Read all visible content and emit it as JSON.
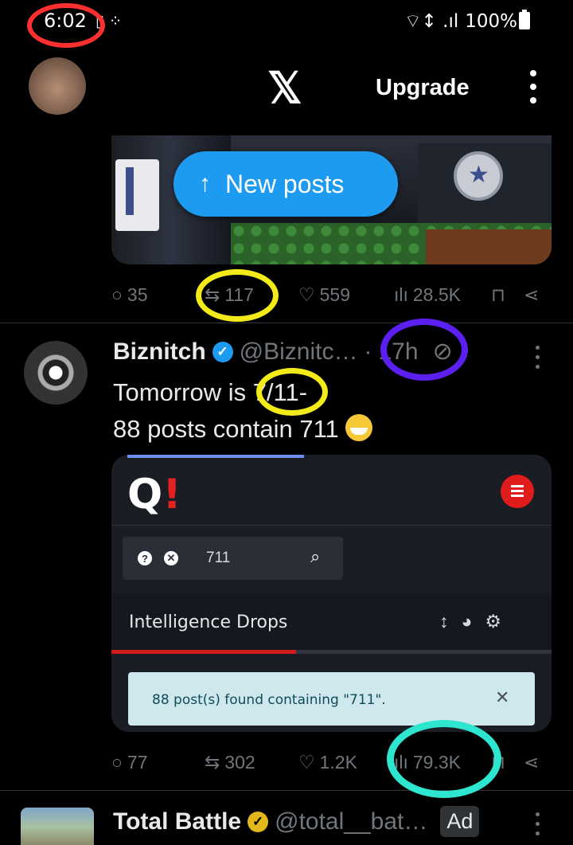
{
  "status_bar": {
    "time": "6:02",
    "left_icons": "▯ ⁘",
    "signal": "⌔↕ .ıl",
    "battery_pct": "100%"
  },
  "header": {
    "logo": "𝕏",
    "upgrade_label": "Upgrade"
  },
  "new_posts": {
    "label": "New posts",
    "arrow": "↑"
  },
  "post1": {
    "metrics": {
      "replies": "35",
      "reposts": "117",
      "likes": "559",
      "views": "28.5K"
    }
  },
  "post2": {
    "author_name": "Biznitch",
    "handle": "@Biznitc…",
    "separator": "·",
    "time": "17h",
    "text_line1": "Tomorrow is 7/11-",
    "text_line2": "88 posts contain 711",
    "embed": {
      "logo_q": "Q",
      "logo_bang": "!",
      "search_value": "711",
      "help_icon": "?",
      "clear_icon": "✕",
      "search_icon": "⌕",
      "section_label": "Intelligence Drops",
      "result_message": "88 post(s) found containing \"711\".",
      "close_glyph": "✕"
    },
    "metrics": {
      "replies": "77",
      "reposts": "302",
      "likes": "1.2K",
      "views": "79.3K"
    }
  },
  "post3": {
    "author_name": "Total Battle",
    "handle": "@total__bat…",
    "ad_label": "Ad"
  },
  "icons": {
    "reply": "○",
    "repost": "⇆",
    "like": "♡",
    "views": "ılı",
    "bookmark": "⊓",
    "share": "⋖",
    "verified": "✓",
    "grok": "⊘"
  },
  "annotations": {
    "red": "#ff3030",
    "yellow": "#f2ea19",
    "purple": "#5b1ff0",
    "teal": "#2ee6d0"
  }
}
